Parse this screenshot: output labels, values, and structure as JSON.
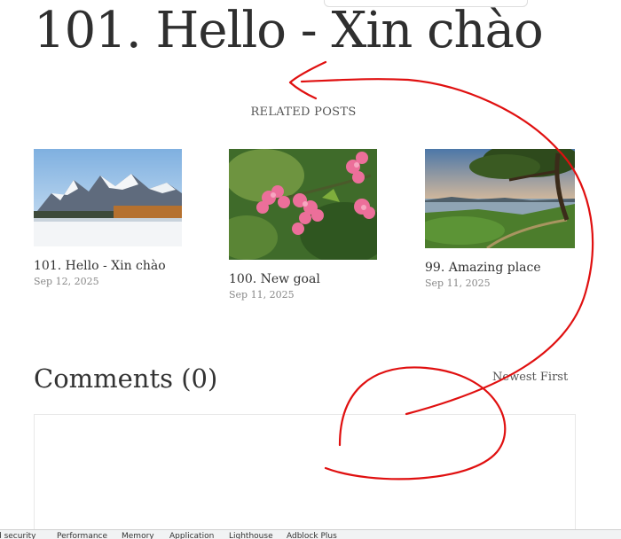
{
  "page": {
    "title": "101. Hello - Xin chào"
  },
  "related": {
    "heading": "RELATED POSTS",
    "posts": [
      {
        "title": "101. Hello - Xin chào",
        "date": "Sep 12, 2025",
        "image": "snowy-mountain-landscape"
      },
      {
        "title": "100. New goal",
        "date": "Sep 11, 2025",
        "image": "pink-flowers"
      },
      {
        "title": "99. Amazing place",
        "date": "Sep 11, 2025",
        "image": "tree-by-lake-sunset"
      }
    ]
  },
  "comments": {
    "title": "Comments (0)",
    "sort_label": "Newest First"
  },
  "devtools": {
    "tabs": [
      "d security",
      "Performance",
      "Memory",
      "Application",
      "Lighthouse",
      "Adblock Plus"
    ]
  },
  "annotation": {
    "color": "#e01010"
  }
}
